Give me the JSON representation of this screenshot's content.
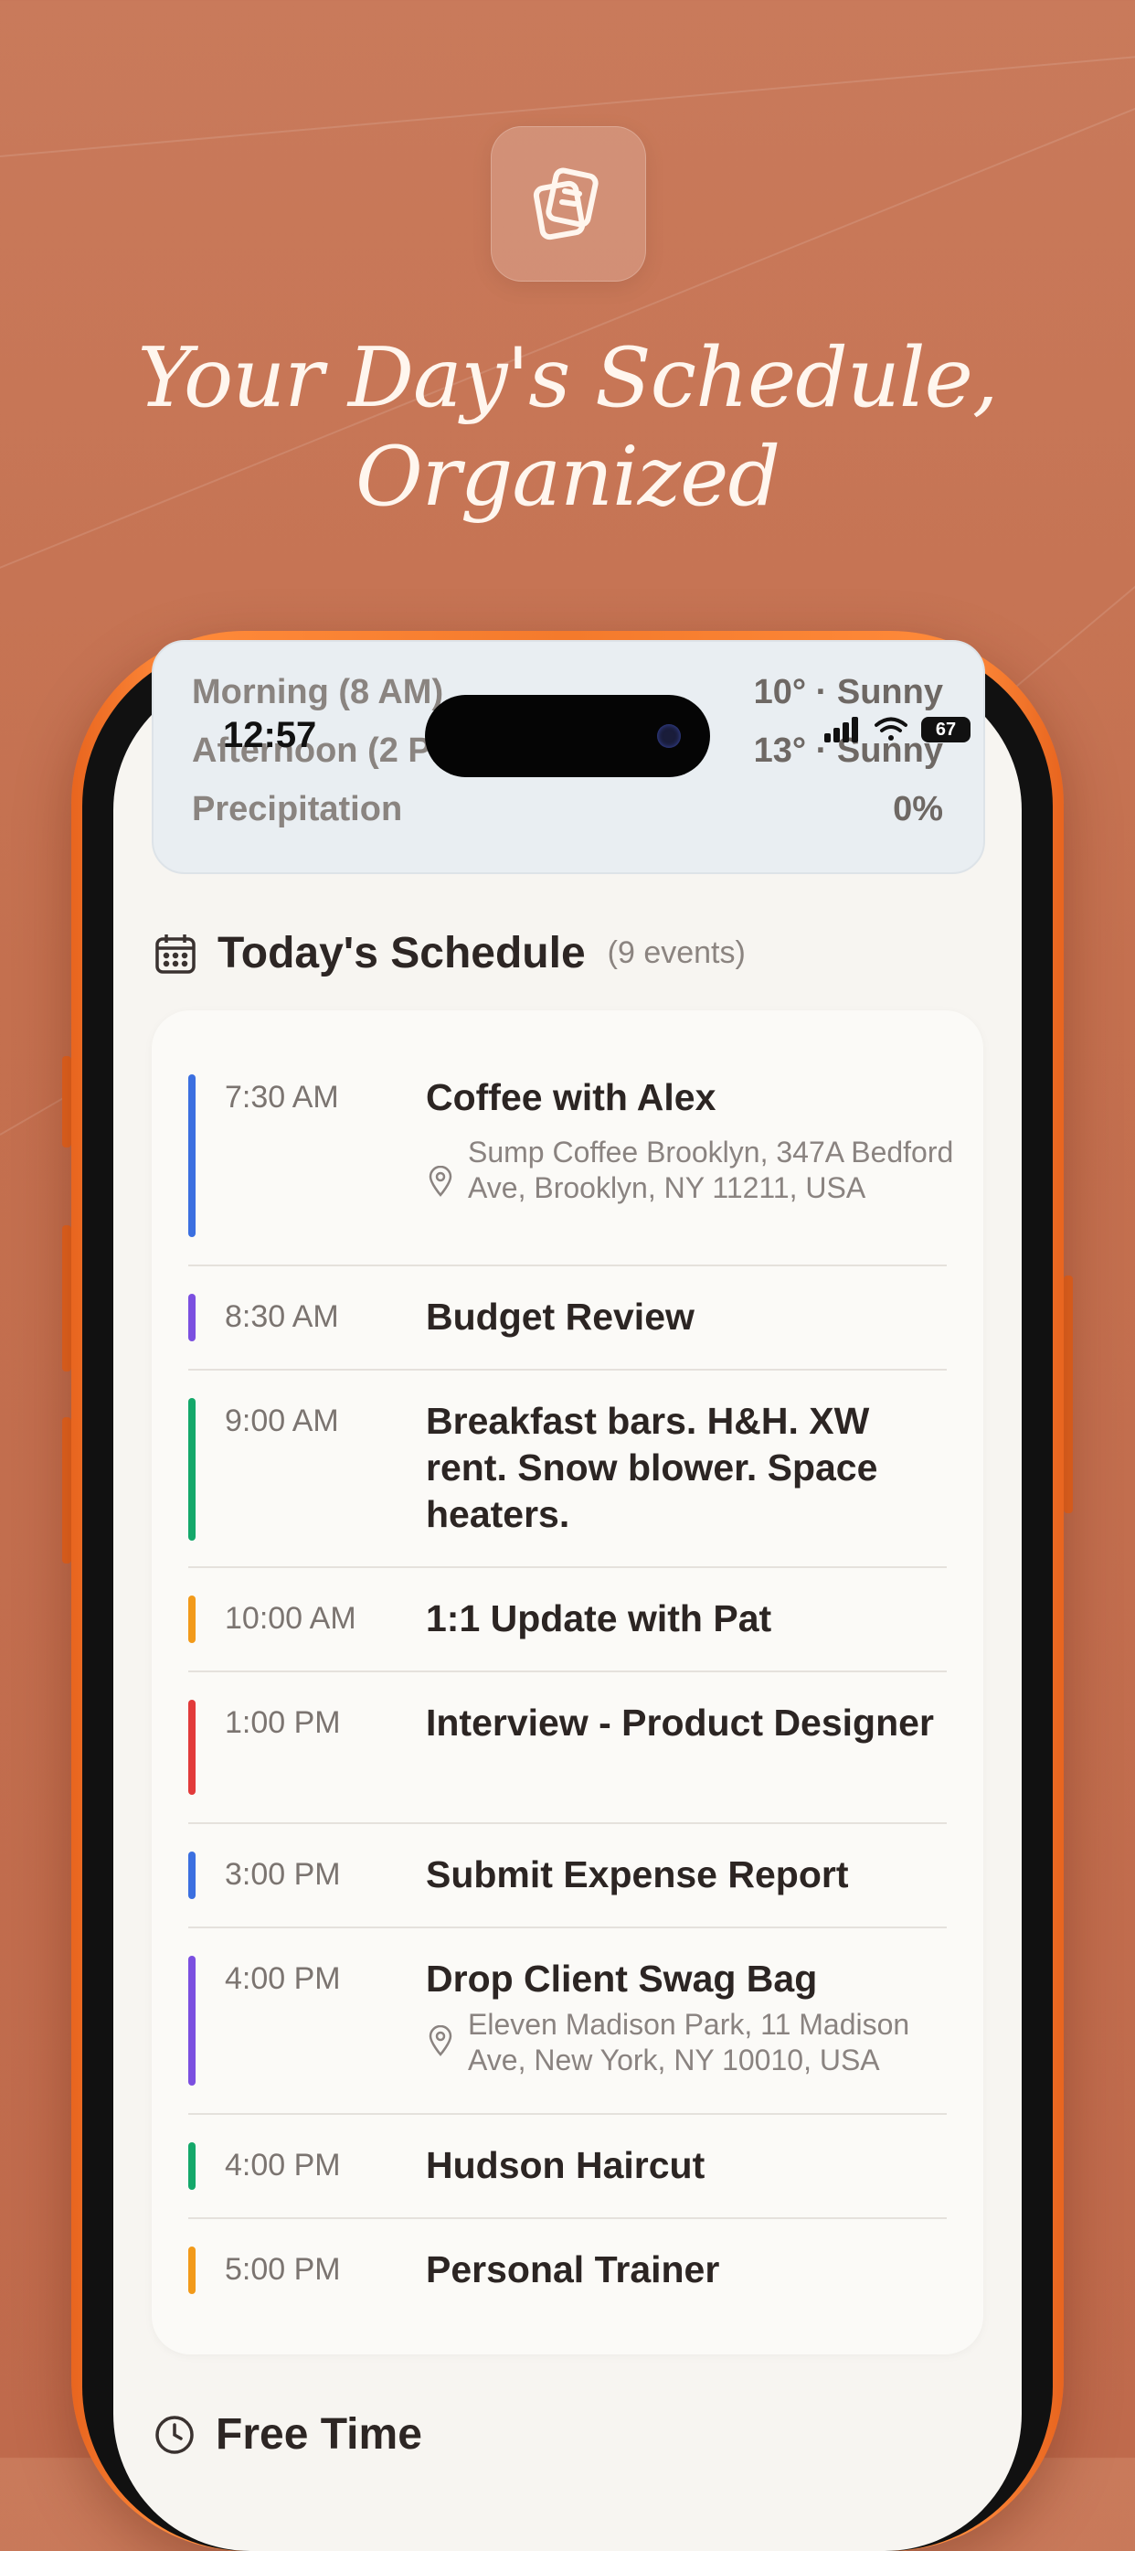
{
  "hero": {
    "title_line1": "Your Day's Schedule,",
    "title_line2": "Organized"
  },
  "status_bar": {
    "time": "12:57",
    "battery": "67"
  },
  "weather": {
    "rows": [
      {
        "label": "Morning (8 AM)",
        "value": "10° · Sunny"
      },
      {
        "label": "Afternoon (2 PM)",
        "value": "13° · Sunny"
      },
      {
        "label": "Precipitation",
        "value": "0%"
      }
    ]
  },
  "schedule": {
    "title": "Today's Schedule",
    "count": "(9 events)",
    "events": [
      {
        "time": "7:30 AM",
        "title": "Coffee with Alex",
        "location": "Sump Coffee Brooklyn, 347A Bedford Ave, Brooklyn, NY 11211, USA",
        "color": "#3b6fe0"
      },
      {
        "time": "8:30 AM",
        "title": "Budget Review",
        "location": "",
        "color": "#7b4fe0"
      },
      {
        "time": "9:00 AM",
        "title": "Breakfast bars. H&H. XW rent. Snow blower. Space heaters.",
        "location": "",
        "color": "#14a86a"
      },
      {
        "time": "10:00 AM",
        "title": "1:1 Update with Pat",
        "location": "",
        "color": "#f29a1a"
      },
      {
        "time": "1:00 PM",
        "title": "Interview - Product Designer",
        "location": "",
        "color": "#e23a3a"
      },
      {
        "time": "3:00 PM",
        "title": "Submit Expense Report",
        "location": "",
        "color": "#3b6fe0"
      },
      {
        "time": "4:00 PM",
        "title": "Drop Client Swag Bag",
        "location": "Eleven Madison Park, 11 Madison Ave, New York, NY 10010, USA",
        "color": "#7b4fe0"
      },
      {
        "time": "4:00 PM",
        "title": "Hudson Haircut",
        "location": "",
        "color": "#14a86a"
      },
      {
        "time": "5:00 PM",
        "title": "Personal Trainer",
        "location": "",
        "color": "#f29a1a"
      }
    ]
  },
  "free_time": {
    "title": "Free Time"
  }
}
